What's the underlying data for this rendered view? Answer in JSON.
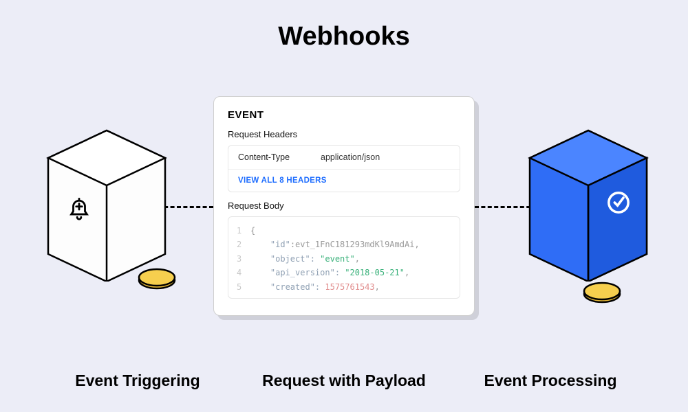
{
  "title": "Webhooks",
  "left_label": "Event Triggering",
  "center_label": "Request with Payload",
  "right_label": "Event Processing",
  "panel": {
    "title": "EVENT",
    "headers_label": "Request Headers",
    "header_key": "Content-Type",
    "header_value": "application/json",
    "view_all": "VIEW ALL 8 HEADERS",
    "body_label": "Request Body",
    "code": {
      "l1": "{",
      "l2_key": "\"id\"",
      "l2_val": ":evt_1FnC181293mdKl9AmdAi",
      "l3_key": "\"object\":",
      "l3_val": " \"event\"",
      "l4_key": "\"api_version\":",
      "l4_val": " \"2018-05-21\"",
      "l5_key": "\"created\":",
      "l5_val": " 1575761543",
      "comma": ","
    }
  }
}
